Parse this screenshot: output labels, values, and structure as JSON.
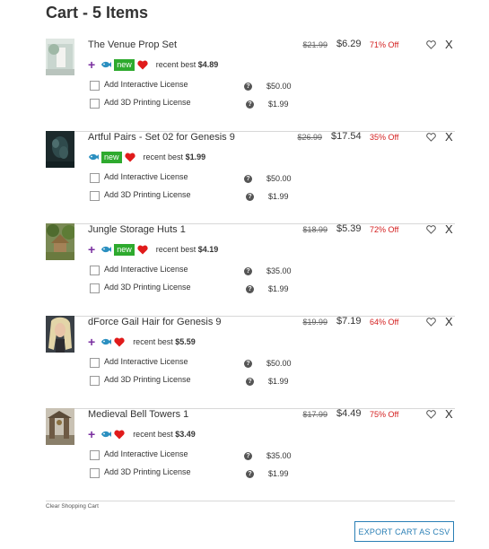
{
  "cart": {
    "title": "Cart - 5 Items",
    "clear_label": "Clear Shopping Cart",
    "export_label": "EXPORT CART AS CSV"
  },
  "colors": {
    "accent": "#2a7fb5",
    "sale": "#d42020",
    "new_badge": "#2eaa2e",
    "plus": "#7a2fa0",
    "heart": "#e01b1b"
  },
  "items": [
    {
      "name": "The Venue Prop Set",
      "original_price": "$21.99",
      "price": "$6.29",
      "discount": "71% Off",
      "has_plus": true,
      "has_new": true,
      "new_label": "new",
      "best_prefix": "recent best",
      "best_price": "$4.89",
      "licenses": [
        {
          "label": "Add Interactive License",
          "price": "$50.00"
        },
        {
          "label": "Add 3D Printing License",
          "price": "$1.99"
        }
      ]
    },
    {
      "name": "Artful Pairs - Set 02 for Genesis 9",
      "original_price": "$26.99",
      "price": "$17.54",
      "discount": "35% Off",
      "has_plus": false,
      "has_new": true,
      "new_label": "new",
      "best_prefix": "recent best",
      "best_price": "$1.99",
      "licenses": [
        {
          "label": "Add Interactive License",
          "price": "$50.00"
        },
        {
          "label": "Add 3D Printing License",
          "price": "$1.99"
        }
      ]
    },
    {
      "name": "Jungle Storage Huts 1",
      "original_price": "$18.99",
      "price": "$5.39",
      "discount": "72% Off",
      "has_plus": true,
      "has_new": true,
      "new_label": "new",
      "best_prefix": "recent best",
      "best_price": "$4.19",
      "licenses": [
        {
          "label": "Add Interactive License",
          "price": "$35.00"
        },
        {
          "label": "Add 3D Printing License",
          "price": "$1.99"
        }
      ]
    },
    {
      "name": "dForce Gail Hair for Genesis 9",
      "original_price": "$19.99",
      "price": "$7.19",
      "discount": "64% Off",
      "has_plus": true,
      "has_new": false,
      "new_label": "",
      "best_prefix": "recent best",
      "best_price": "$5.59",
      "licenses": [
        {
          "label": "Add Interactive License",
          "price": "$50.00"
        },
        {
          "label": "Add 3D Printing License",
          "price": "$1.99"
        }
      ]
    },
    {
      "name": "Medieval Bell Towers 1",
      "original_price": "$17.99",
      "price": "$4.49",
      "discount": "75% Off",
      "has_plus": true,
      "has_new": false,
      "new_label": "",
      "best_prefix": "recent best",
      "best_price": "$3.49",
      "licenses": [
        {
          "label": "Add Interactive License",
          "price": "$35.00"
        },
        {
          "label": "Add 3D Printing License",
          "price": "$1.99"
        }
      ]
    }
  ],
  "help_glyph": "?",
  "remove_glyph": "X"
}
